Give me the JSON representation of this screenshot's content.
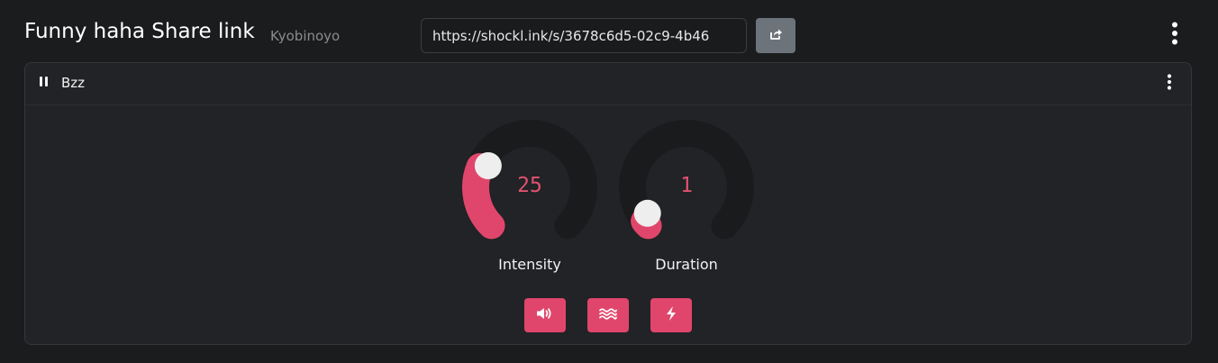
{
  "header": {
    "title": "Funny haha Share link",
    "owner": "Kyobinoyo",
    "share_url": "https://shockl.ink/s/3678c6d5-02c9-4b46",
    "share_icon": "share-icon",
    "menu_icon": "kebab-menu-icon"
  },
  "shocker": {
    "name": "Bzz",
    "state_icon": "pause-icon",
    "menu_icon": "kebab-menu-icon",
    "intensity": {
      "label": "Intensity",
      "value": "25",
      "min": 0,
      "max": 100
    },
    "duration": {
      "label": "Duration",
      "value": "1",
      "min": 0.3,
      "max": 30
    },
    "actions": [
      {
        "name": "sound",
        "icon": "volume-icon"
      },
      {
        "name": "vibrate",
        "icon": "vibration-waves-icon"
      },
      {
        "name": "shock",
        "icon": "lightning-bolt-icon"
      }
    ]
  },
  "colors": {
    "accent": "#e0466b",
    "track": "#1a1b1d",
    "background": "#1b1c1e",
    "card": "#212326"
  }
}
